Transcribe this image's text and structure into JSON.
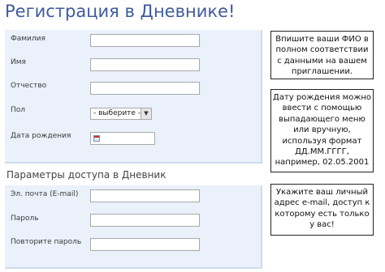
{
  "page": {
    "title": "Регистрация в Дневнике!",
    "access_section_title": "Параметры доступа в Дневник"
  },
  "personal": {
    "last_name_label": "Фамилия",
    "first_name_label": "Имя",
    "middle_name_label": "Отчество",
    "gender_label": "Пол",
    "gender_selected": "- выберите -",
    "birth_date_label": "Дата рождения"
  },
  "access": {
    "email_label": "Эл. почта (E-mail)",
    "password_label": "Пароль",
    "repeat_password_label": "Повторите пароль"
  },
  "hints": [
    "Впишите ваши ФИО в полном соответствии с данными на вашем приглашении.",
    "Дату рождения можно ввести с помощью выпадающего меню или вручную, используя формат ДД.ММ.ГГГГ, например, 02.05.2001",
    "Укажите ваш личный адрес e-mail, доступ к которому есть только у вас!"
  ],
  "colors": {
    "title": "#3f5b9e",
    "panel_bg": "#eaf1fb"
  },
  "icons": {
    "gender_dropdown": "chevron-down-icon",
    "date_picker": "calendar-icon"
  }
}
